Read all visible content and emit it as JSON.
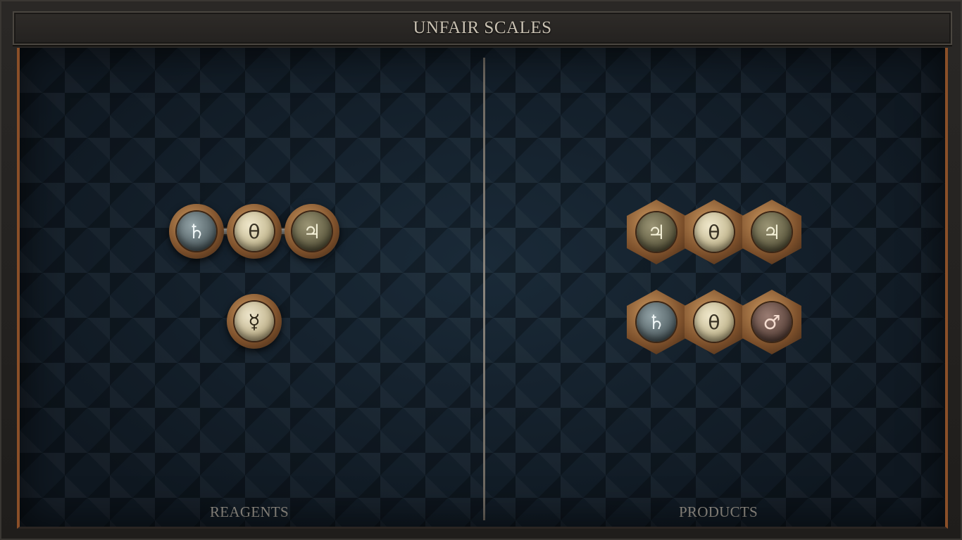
{
  "title": "UNFAIR SCALES",
  "panels": {
    "left_label": "REAGENTS",
    "right_label": "PRODUCTS"
  },
  "reagents": [
    {
      "atoms": [
        {
          "element": "lead",
          "symbol": "♄"
        },
        {
          "element": "salt",
          "symbol": "θ"
        },
        {
          "element": "tin",
          "symbol": "♃"
        }
      ]
    },
    {
      "atoms": [
        {
          "element": "quicksilver",
          "symbol": "☿"
        }
      ]
    }
  ],
  "products": [
    {
      "atoms": [
        {
          "element": "tin",
          "symbol": "♃"
        },
        {
          "element": "salt",
          "symbol": "θ"
        },
        {
          "element": "tin",
          "symbol": "♃"
        }
      ]
    },
    {
      "atoms": [
        {
          "element": "lead",
          "symbol": "♄"
        },
        {
          "element": "salt",
          "symbol": "θ"
        },
        {
          "element": "iron",
          "symbol": "♂"
        }
      ]
    }
  ],
  "colors": {
    "frame_accent": "#8a4f28",
    "board_bg": "#121c26",
    "label_text": "#9a958c"
  }
}
